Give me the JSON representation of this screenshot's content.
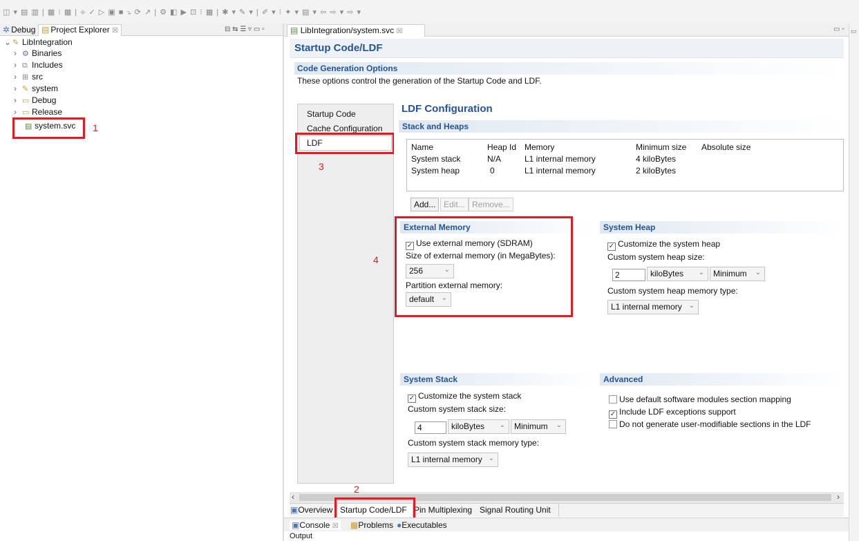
{
  "toolbar": {
    "glyphs_left": "◫ ▾ ▤ ▥ | ▦ ⁝ ▦ | ⟡ ✓ ▷ ▣ ■ ⤵ ⟳ ↗ | ⚙ ◧ ▶ ⊡ ⁝ ▦ | ✱ ▾ ✎ ▾ | ✐ ▾ ⁝ ✦ ▾ ▤ ▾ ⇦ ⇨ ▾ ⇨ ▾"
  },
  "left_panel": {
    "tab_debug": "Debug",
    "tab_project_explorer": "Project Explorer",
    "tab_close": "☒",
    "tab_tools": "⊟ ⇆ ☰ ▿ ▭ ▫",
    "tree": {
      "root": "LibIntegration",
      "items": [
        "Binaries",
        "Includes",
        "src",
        "system",
        "Debug",
        "Release"
      ],
      "selected_file": "system.svc"
    }
  },
  "editor": {
    "tab_title": "LibIntegration/system.svc",
    "tab_close": "☒",
    "min_max": "▭ ▫",
    "form_title": "Startup Code/LDF",
    "cgo_heading": "Code Generation Options",
    "cgo_description": "These options control the generation of the Startup Code and LDF.",
    "nav": [
      "Startup Code",
      "Cache Configuration",
      "LDF"
    ],
    "ldf_title": "LDF Configuration",
    "stack_heaps_heading": "Stack and Heaps",
    "table": {
      "headers": [
        "Name",
        "Heap Id",
        "Memory",
        "Minimum size",
        "Absolute size"
      ],
      "rows": [
        [
          "System stack",
          "N/A",
          "L1 internal memory",
          "4 kiloBytes",
          ""
        ],
        [
          "System heap",
          "0",
          "L1 internal memory",
          "2 kiloBytes",
          ""
        ]
      ]
    },
    "buttons": {
      "add": "Add...",
      "edit": "Edit...",
      "remove": "Remove..."
    },
    "external_memory": {
      "heading": "External Memory",
      "use_label": "Use external memory (SDRAM)",
      "use_checked": true,
      "size_label": "Size of external memory (in MegaBytes):",
      "size_value": "256",
      "partition_label": "Partition external memory:",
      "partition_value": "default"
    },
    "system_heap": {
      "heading": "System Heap",
      "customize_label": "Customize the system heap",
      "customize_checked": true,
      "size_label": "Custom system heap size:",
      "size_value": "2",
      "unit": "kiloBytes",
      "mode": "Minimum",
      "type_label": "Custom system heap memory type:",
      "type_value": "L1 internal memory"
    },
    "system_stack": {
      "heading": "System Stack",
      "customize_label": "Customize the system stack",
      "customize_checked": true,
      "size_label": "Custom system stack size:",
      "size_value": "4",
      "unit": "kiloBytes",
      "mode": "Minimum",
      "type_label": "Custom system stack memory type:",
      "type_value": "L1 internal memory"
    },
    "advanced": {
      "heading": "Advanced",
      "options": [
        {
          "label": "Use default software modules section mapping",
          "checked": false
        },
        {
          "label": "Include LDF exceptions support",
          "checked": true
        },
        {
          "label": "Do not generate user-modifiable sections in the LDF",
          "checked": false
        }
      ]
    },
    "page_tabs": [
      "Overview",
      "Startup Code/LDF",
      "Pin Multiplexing",
      "Signal Routing Unit"
    ]
  },
  "bottom": {
    "tabs": [
      "Console",
      "Problems",
      "Executables"
    ],
    "output_label": "Output"
  },
  "annotations": {
    "markers": [
      "1",
      "2",
      "3",
      "4"
    ],
    "color": "#e01b24"
  }
}
